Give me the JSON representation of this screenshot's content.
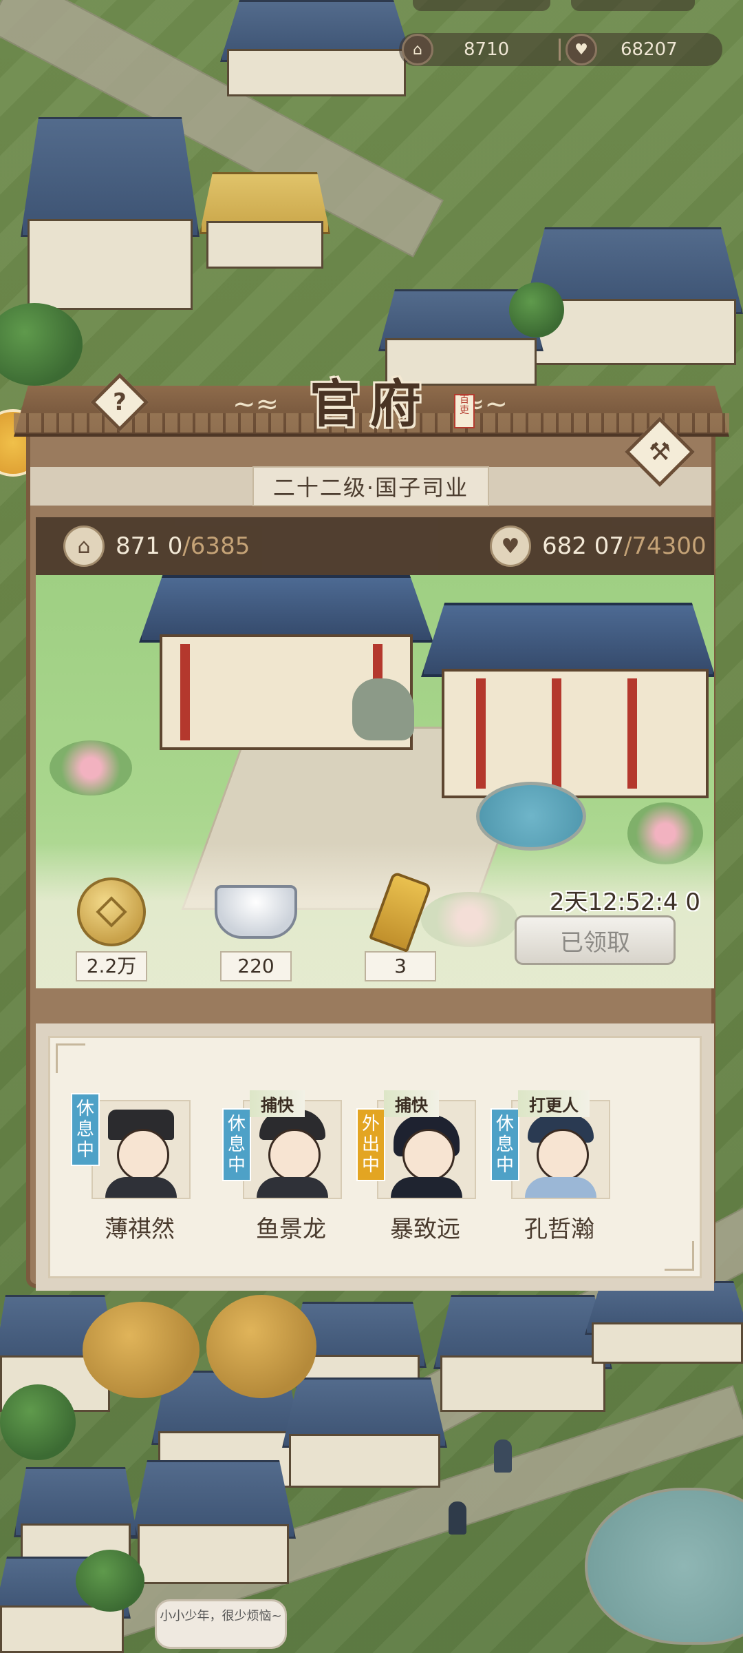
{
  "topbar": {
    "reputation": "8710",
    "favor": "68207",
    "reputation_icon": "hall-icon",
    "favor_icon": "heart-icon"
  },
  "panel": {
    "title": "官府",
    "seal_text": "百吏",
    "rank": "二十二级·国子司业",
    "stats": {
      "reputation_current": "871 0",
      "reputation_max": "/6385",
      "favor_current": "682 07",
      "favor_max": "/74300"
    },
    "rewards": [
      {
        "icon": "copper-coin-icon",
        "value": "2.2万"
      },
      {
        "icon": "silver-ingot-icon",
        "value": "220"
      },
      {
        "icon": "token-icon",
        "value": "3"
      }
    ],
    "timer": "2天12:52:4 0",
    "claim_label": "已领取"
  },
  "staff": [
    {
      "name": "薄祺然",
      "status": "休息中",
      "status_type": "rest",
      "role": ""
    },
    {
      "name": "鱼景龙",
      "status": "休息中",
      "status_type": "rest",
      "role": "捕快"
    },
    {
      "name": "暴致远",
      "status": "外出中",
      "status_type": "out",
      "role": "捕快"
    },
    {
      "name": "孔哲瀚",
      "status": "休息中",
      "status_type": "rest",
      "role": "打更人"
    }
  ],
  "speech": "小小少年，很少烦恼~",
  "colors": {
    "frame": "#7b5a3e",
    "status_rest": "#4ea1c7",
    "status_out": "#e3a522",
    "stat_max": "#c9a77a"
  }
}
